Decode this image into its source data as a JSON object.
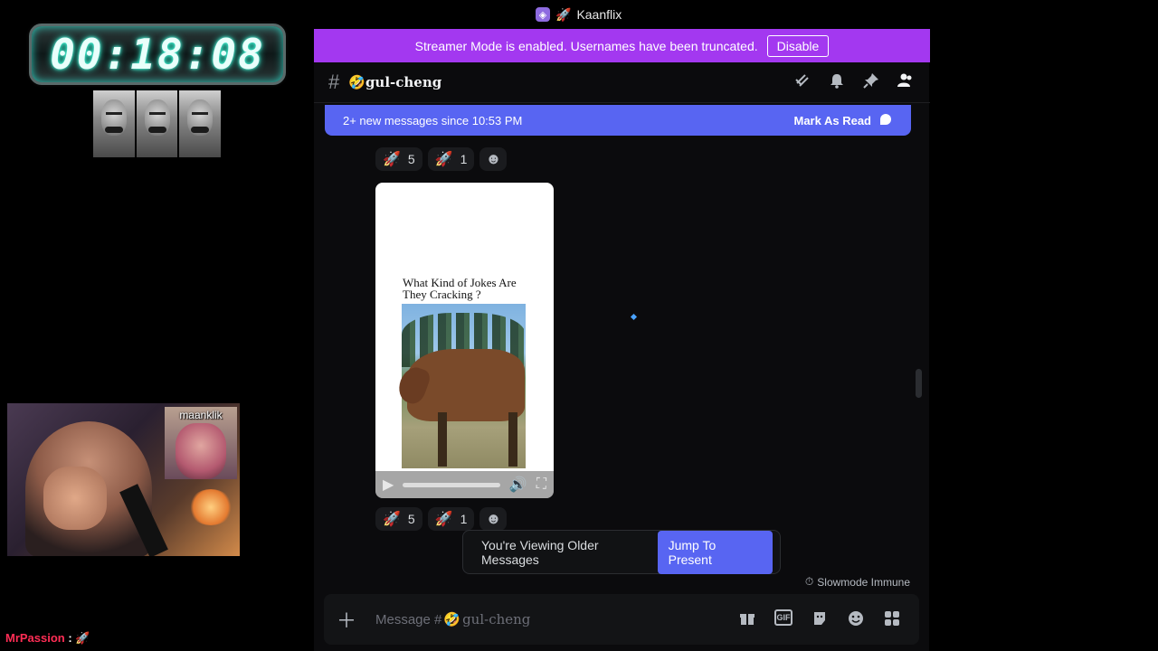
{
  "overlay": {
    "timer": "00:18:08",
    "webcam_pip_label": "maanklik",
    "chat_user": "MrPassion",
    "chat_separator": ":",
    "chat_emote": "rocket-emote"
  },
  "window": {
    "app_name": "Kaanflix",
    "app_icon": "discord-nitro-icon",
    "app_emoji": "rocket-icon"
  },
  "banner": {
    "text": "Streamer Mode is enabled. Usernames have been truncated.",
    "button": "Disable",
    "color": "#a338f0"
  },
  "channel": {
    "hash": "#",
    "emoji": "🤣",
    "name": "gul-cheng",
    "header_icons": [
      "threads-icon",
      "bell-icon",
      "pin-icon",
      "members-icon"
    ]
  },
  "new_messages": {
    "text": "2+ new messages since 10:53 PM",
    "action": "Mark As Read",
    "color": "#5865f2"
  },
  "reactions_top": [
    {
      "emoji": "🚀",
      "count": "5"
    },
    {
      "emoji": "🚀",
      "count": "1"
    }
  ],
  "video": {
    "caption": "What Kind of Jokes Are They Cracking ?",
    "progress": 0
  },
  "reactions_bottom": [
    {
      "emoji": "🚀",
      "count": "5"
    },
    {
      "emoji": "🚀",
      "count": "1"
    }
  ],
  "older_messages": {
    "text": "You're Viewing Older Messages",
    "button": "Jump To Present"
  },
  "slowmode": "Slowmode Immune",
  "composer": {
    "placeholder_prefix": "Message #",
    "emoji": "🤣",
    "channel": "gul-cheng",
    "icons": [
      "gift-icon",
      "gif-icon",
      "sticker-icon",
      "emoji-icon",
      "apps-icon"
    ],
    "gif_label": "GIF"
  }
}
